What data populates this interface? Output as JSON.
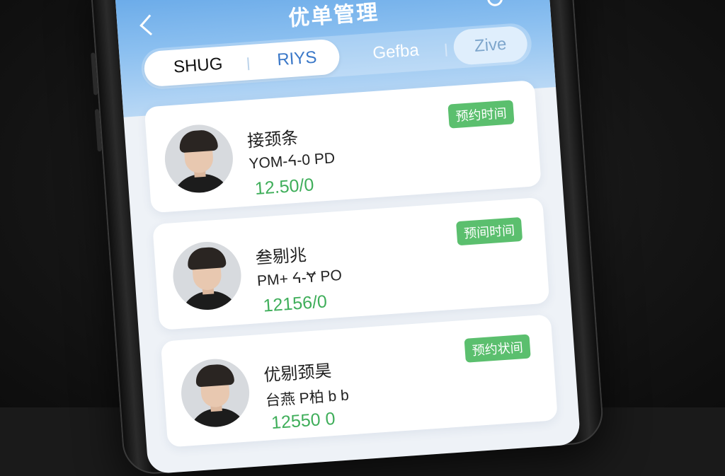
{
  "header": {
    "title": "优单管理"
  },
  "tabs": [
    {
      "label": "SHUG"
    },
    {
      "label": "RIYS"
    },
    {
      "label": "Gefba"
    },
    {
      "label": "Zive"
    }
  ],
  "orders": [
    {
      "name": "接颈条",
      "time": "YOM-ᔦ-0 PD",
      "price": "12.50/0",
      "status": "预约时间"
    },
    {
      "name": "叁剔兆",
      "time": "PM+ ᔦ-Ɏ PO",
      "price": "12156/0",
      "status": "预间时间"
    },
    {
      "name": "优剔颈昊",
      "time": "台燕 P柏 b b",
      "price": "12550 0",
      "status": "预约状间"
    }
  ],
  "colors": {
    "header_blue": "#5ea3e6",
    "status_green": "#5bbf6e",
    "price_green": "#3fae5a"
  },
  "icons": [
    "back-icon",
    "refresh-icon",
    "menu-icon"
  ]
}
